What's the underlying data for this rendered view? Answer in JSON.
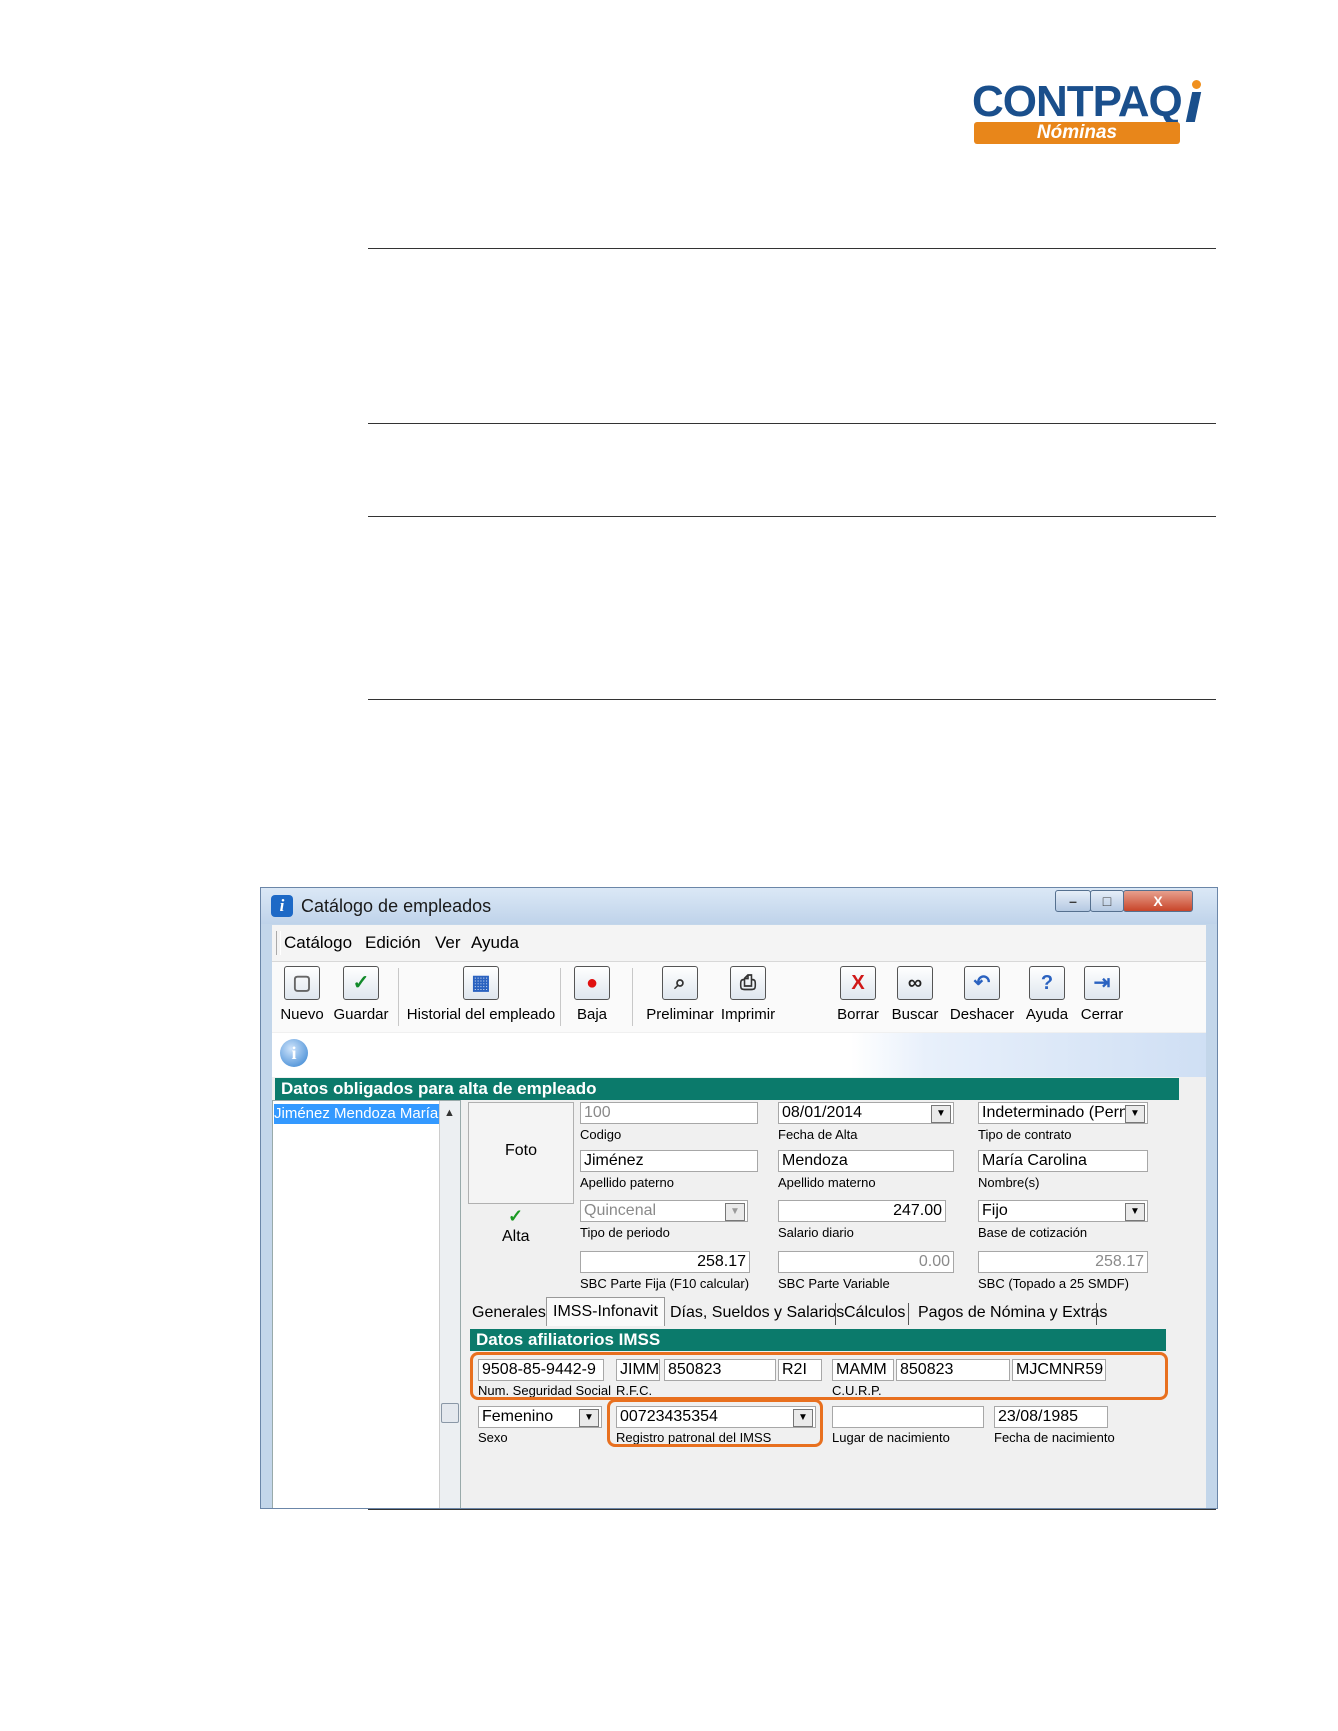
{
  "logo": {
    "brand": "CONTPAQ",
    "product": "Nóminas"
  },
  "window": {
    "title": "Catálogo de empleados",
    "caption_buttons": {
      "minimize": "–",
      "maximize": "□",
      "close": "X"
    }
  },
  "menu": [
    "Catálogo",
    "Edición",
    "Ver",
    "Ayuda"
  ],
  "toolbar": {
    "nuevo": "Nuevo",
    "guardar": "Guardar",
    "historial": "Historial del empleado",
    "baja": "Baja",
    "preliminar": "Preliminar",
    "imprimir": "Imprimir",
    "borrar": "Borrar",
    "buscar": "Buscar",
    "deshacer": "Deshacer",
    "ayuda": "Ayuda",
    "cerrar": "Cerrar"
  },
  "section_main": "Datos obligados para alta de empleado",
  "employee_list": {
    "selected": "Jiménez Mendoza María"
  },
  "photo": {
    "label": "Foto",
    "status": "Alta"
  },
  "fields": {
    "codigo": {
      "value": "100",
      "label": "Codigo"
    },
    "fecha_alta": {
      "value": "08/01/2014",
      "label": "Fecha de Alta"
    },
    "tipo_contrato": {
      "value": "Indeterminado (Pern",
      "label": "Tipo de contrato"
    },
    "apellido_paterno": {
      "value": "Jiménez",
      "label": "Apellido paterno"
    },
    "apellido_materno": {
      "value": "Mendoza",
      "label": "Apellido materno"
    },
    "nombres": {
      "value": "María Carolina",
      "label": "Nombre(s)"
    },
    "tipo_periodo": {
      "value": "Quincenal",
      "label": "Tipo de periodo"
    },
    "salario_diario": {
      "value": "247.00",
      "label": "Salario diario"
    },
    "base_cotizacion": {
      "value": "Fijo",
      "label": "Base de cotización"
    },
    "sbc_fija": {
      "value": "258.17",
      "label": "SBC Parte Fija  (F10 calcular)"
    },
    "sbc_variable": {
      "value": "0.00",
      "label": "SBC Parte Variable"
    },
    "sbc_topado": {
      "value": "258.17",
      "label": "SBC (Topado a 25 SMDF)"
    }
  },
  "tabs": [
    "Generales",
    "IMSS-Infonavit",
    "Días, Sueldos y Salarios",
    "Cálculos",
    "Pagos de Nómina y Extras"
  ],
  "section_imss": "Datos afiliatorios IMSS",
  "imss": {
    "nss": {
      "value": "9508-85-9442-9",
      "label": "Num. Seguridad Social"
    },
    "rfc": {
      "part1": "JIMM",
      "part2": "850823",
      "part3": "R2I",
      "label": "R.F.C."
    },
    "curp": {
      "part1": "MAMM",
      "part2": "850823",
      "part3": "MJCMNR59",
      "label": "C.U.R.P."
    },
    "sexo": {
      "value": "Femenino",
      "label": "Sexo"
    },
    "registro_patronal": {
      "value": "00723435354",
      "label": "Registro patronal del IMSS"
    },
    "lugar_nacimiento": {
      "value": "",
      "label": "Lugar de nacimiento"
    },
    "fecha_nacimiento": {
      "value": "23/08/1985",
      "label": "Fecha de nacimiento"
    }
  },
  "colors": {
    "section": "#0b7a6b",
    "highlight": "#e8701f",
    "selection": "#3399ff",
    "logo_blue": "#1a4f8c",
    "logo_orange": "#e8861a"
  }
}
